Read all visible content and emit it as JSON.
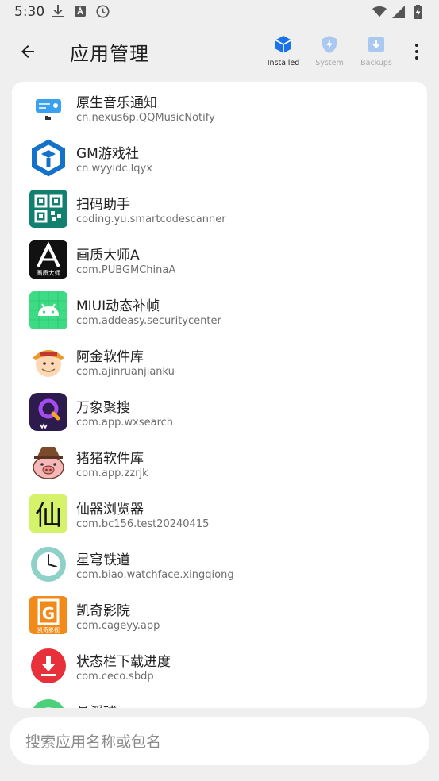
{
  "status_bar": {
    "time": "5:30",
    "left_icons": [
      "download-icon",
      "translate-a-icon",
      "clock-icon"
    ],
    "right_icons": [
      "wifi-icon",
      "signal-icon",
      "battery-charging-icon"
    ]
  },
  "header": {
    "title": "应用管理",
    "tabs": [
      {
        "label": "Installed",
        "icon": "cube-icon",
        "active": true,
        "color": "#1a73e8"
      },
      {
        "label": "System",
        "icon": "shield-bolt-icon",
        "active": false,
        "color": "#aac8f0"
      },
      {
        "label": "Backups",
        "icon": "backup-download-icon",
        "active": false,
        "color": "#aac8f0"
      }
    ]
  },
  "apps": [
    {
      "name": "原生音乐通知",
      "package": "cn.nexus6p.QQMusicNotify",
      "icon": "music-notify-icon"
    },
    {
      "name": "GM游戏社",
      "package": "cn.wyyidc.lqyx",
      "icon": "gm-cube-icon"
    },
    {
      "name": "扫码助手",
      "package": "coding.yu.smartcodescanner",
      "icon": "qr-code-icon"
    },
    {
      "name": "画质大师A",
      "package": "com.PUBGMChinaA",
      "icon": "letter-a-icon"
    },
    {
      "name": "MIUI动态补帧",
      "package": "com.addeasy.securitycenter",
      "icon": "android-icon"
    },
    {
      "name": "阿金软件库",
      "package": "com.ajinruanjianku",
      "icon": "ajin-avatar-icon"
    },
    {
      "name": "万象聚搜",
      "package": "com.app.wxsearch",
      "icon": "wx-search-icon"
    },
    {
      "name": "猪猪软件库",
      "package": "com.app.zzrjk",
      "icon": "pig-icon"
    },
    {
      "name": "仙器浏览器",
      "package": "com.bc156.test20240415",
      "icon": "xian-glyph-icon"
    },
    {
      "name": "星穹铁道",
      "package": "com.biao.watchface.xingqiong",
      "icon": "watchface-icon"
    },
    {
      "name": "凯奇影院",
      "package": "com.cageyy.app",
      "icon": "kaiqi-cinema-icon"
    },
    {
      "name": "状态栏下载进度",
      "package": "com.ceco.sbdp",
      "icon": "download-circle-icon"
    },
    {
      "name": "悬浮球",
      "package": "",
      "icon": "float-ball-icon"
    }
  ],
  "search": {
    "placeholder": "搜索应用名称或包名",
    "value": ""
  },
  "icon_texts": {
    "letter_a_caption": "画质大师",
    "xian_glyph": "仙",
    "kaiqi_letter": "G",
    "kaiqi_caption": "凯奇影视"
  }
}
